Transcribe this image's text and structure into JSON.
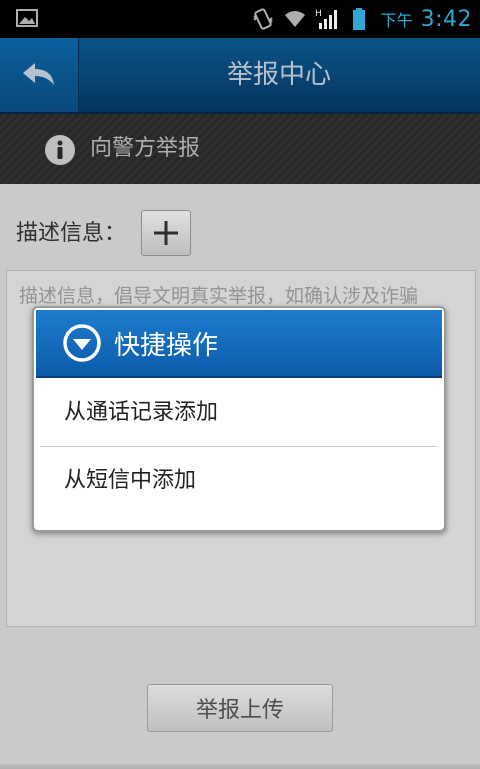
{
  "status_bar": {
    "ampm": "下午",
    "time": "3:42",
    "icons": [
      "image-icon",
      "vibrate-icon",
      "wifi-icon",
      "signal-icon",
      "battery-icon"
    ]
  },
  "header": {
    "title": "举报中心",
    "back_icon": "back-arrow-icon"
  },
  "subheader": {
    "icon": "info-icon",
    "text": "向警方举报"
  },
  "description": {
    "label": "描述信息：",
    "placeholder": "描述信息，倡导文明真实举报，如确认涉及诈骗"
  },
  "submit": {
    "label": "举报上传"
  },
  "dialog": {
    "title": "快捷操作",
    "icon": "chevron-down-circle-icon",
    "items": [
      {
        "label": "从通话记录添加"
      },
      {
        "label": "从短信中添加"
      }
    ]
  },
  "colors": {
    "accent": "#33b5e5",
    "title_bar": "#0b5b95",
    "dialog_header": "#1e7dd0"
  }
}
